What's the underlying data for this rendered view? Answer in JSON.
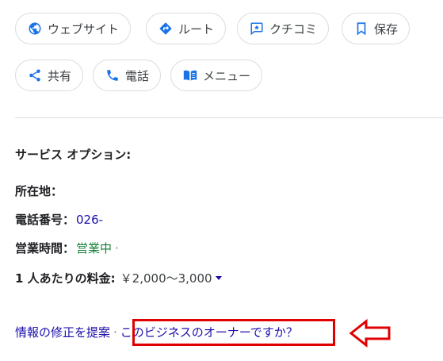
{
  "actions": {
    "website": {
      "label": "ウェブサイト",
      "icon": "globe-icon"
    },
    "route": {
      "label": "ルート",
      "icon": "directions-icon"
    },
    "reviews": {
      "label": "クチコミ",
      "icon": "review-icon"
    },
    "save": {
      "label": "保存",
      "icon": "bookmark-icon"
    },
    "share": {
      "label": "共有",
      "icon": "share-icon"
    },
    "phone": {
      "label": "電話",
      "icon": "phone-icon"
    },
    "menu": {
      "label": "メニュー",
      "icon": "menu-book-icon"
    }
  },
  "info": {
    "service_options_label": "サービス オプション:",
    "address_label": "所在地：",
    "phone_label": "電話番号：",
    "phone_value": "026-",
    "hours_label": "営業時間：",
    "hours_status": "営業中",
    "hours_sep": "·",
    "price_label": "1 人あたりの料金:",
    "price_value": "￥2,000～3,000"
  },
  "footer": {
    "suggest_edit": "情報の修正を提案",
    "separator": "·",
    "owner_question": "このビジネスのオーナーですか？"
  },
  "colors": {
    "link": "#1a0dab",
    "open_status": "#188038",
    "highlight_box": "#e00000",
    "icon_blue": "#1a73e8"
  }
}
